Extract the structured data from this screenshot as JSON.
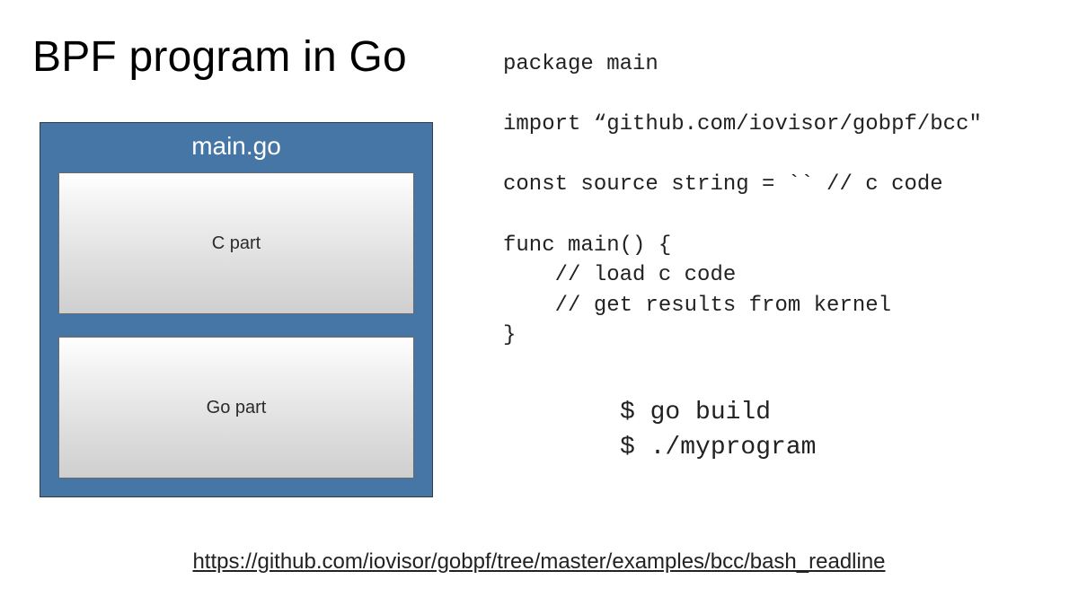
{
  "title": "BPF program in Go",
  "diagram": {
    "header": "main.go",
    "panels": [
      "C part",
      "Go part"
    ]
  },
  "code_lines": [
    "package main",
    "",
    "import “github.com/iovisor/gobpf/bcc\"",
    "",
    "const source string = `` // c code",
    "",
    "func main() {",
    "    // load c code",
    "    // get results from kernel",
    "}"
  ],
  "terminal_lines": [
    "$ go build",
    "$ ./myprogram"
  ],
  "footer_url": "https://github.com/iovisor/gobpf/tree/master/examples/bcc/bash_readline"
}
